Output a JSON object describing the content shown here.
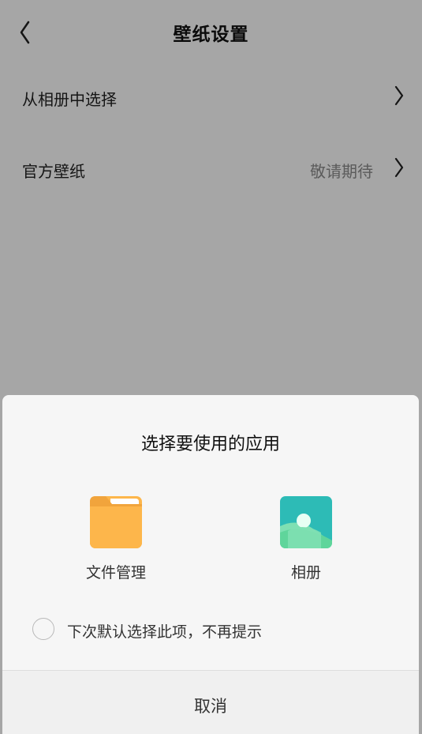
{
  "header": {
    "title": "壁纸设置"
  },
  "rows": [
    {
      "label": "从相册中选择"
    },
    {
      "label": "官方壁纸",
      "value": "敬请期待"
    }
  ],
  "sheet": {
    "title": "选择要使用的应用",
    "apps": [
      {
        "label": "文件管理",
        "icon": "folder-icon"
      },
      {
        "label": "相册",
        "icon": "gallery-icon"
      }
    ],
    "remember_label": "下次默认选择此项，不再提示",
    "cancel_label": "取消"
  },
  "colors": {
    "folder": "#fdb64b",
    "gallery_top": "#2dbbb6",
    "gallery_bottom": "#5fd59b",
    "scrim": "#a6a6a6",
    "sheet_bg": "#f6f6f6"
  }
}
